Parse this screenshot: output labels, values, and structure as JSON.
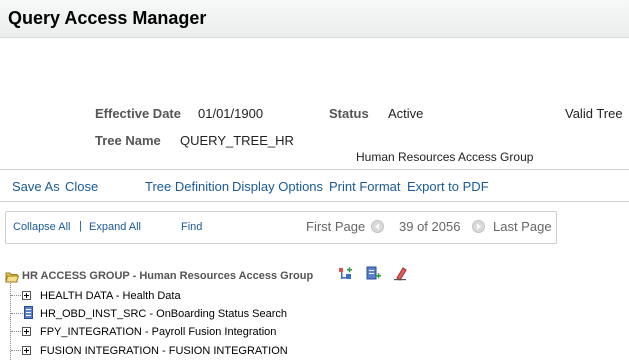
{
  "header": {
    "title": "Query Access Manager"
  },
  "details": {
    "effective_date_label": "Effective Date",
    "effective_date_value": "01/01/1900",
    "status_label": "Status",
    "status_value": "Active",
    "valid_tree": "Valid Tree",
    "tree_name_label": "Tree Name",
    "tree_name_value": "QUERY_TREE_HR",
    "description": "Human Resources Access Group"
  },
  "toolbar": {
    "save_as": "Save As",
    "close": "Close",
    "tree_definition": "Tree Definition",
    "display_options": "Display Options",
    "print_format": "Print Format",
    "export_to_pdf": "Export to PDF"
  },
  "nav": {
    "collapse_all": "Collapse All",
    "separator": "|",
    "expand_all": "Expand All",
    "find": "Find",
    "first_page": "First Page",
    "page_position": "39 of 2056",
    "last_page": "Last Page"
  },
  "tree": {
    "root_label": "HR ACCESS GROUP - Human Resources Access Group",
    "items": [
      {
        "label": "HEALTH DATA - Health Data",
        "kind": "group"
      },
      {
        "label": "HR_OBD_INST_SRC - OnBoarding Status Search",
        "kind": "record"
      },
      {
        "label": "FPY_INTEGRATION - Payroll Fusion Integration",
        "kind": "group"
      },
      {
        "label": "FUSION INTEGRATION - FUSION INTEGRATION",
        "kind": "group"
      }
    ]
  },
  "colors": {
    "link": "#1a5a96",
    "label": "#555555",
    "title": "#000000"
  }
}
